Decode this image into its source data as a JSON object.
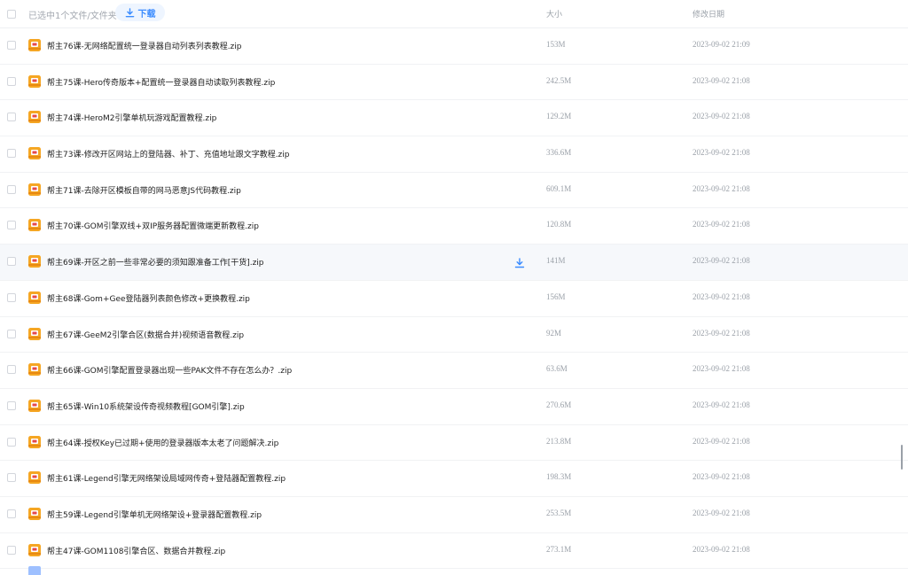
{
  "header": {
    "selection_text": "已选中1个文件/文件夹",
    "download_label": "下载",
    "col_size": "大小",
    "col_modified": "修改日期"
  },
  "colors": {
    "accent": "#3b8cff",
    "zip_orange": "#f5a623",
    "zip_red": "#e5484d"
  },
  "files": [
    {
      "name": "帮主76课-无网络配置统一登录器自动列表列表教程.zip",
      "size": "153M",
      "modified": "2023-09-02 21:09"
    },
    {
      "name": "帮主75课-Hero传奇版本+配置统一登录器自动读取列表教程.zip",
      "size": "242.5M",
      "modified": "2023-09-02 21:08"
    },
    {
      "name": "帮主74课-HeroM2引擎单机玩游戏配置教程.zip",
      "size": "129.2M",
      "modified": "2023-09-02 21:08"
    },
    {
      "name": "帮主73课-修改开区网站上的登陆器、补丁、充值地址跟文字教程.zip",
      "size": "336.6M",
      "modified": "2023-09-02 21:08"
    },
    {
      "name": "帮主71课-去除开区模板自带的网马恶意JS代码教程.zip",
      "size": "609.1M",
      "modified": "2023-09-02 21:08"
    },
    {
      "name": "帮主70课-GOM引擎双线+双IP服务器配置微端更新教程.zip",
      "size": "120.8M",
      "modified": "2023-09-02 21:08"
    },
    {
      "name": "帮主69课-开区之前一些非常必要的须知跟准备工作[干货].zip",
      "size": "141M",
      "modified": "2023-09-02 21:08"
    },
    {
      "name": "帮主68课-Gom+Gee登陆器列表颜色修改+更换教程.zip",
      "size": "156M",
      "modified": "2023-09-02 21:08"
    },
    {
      "name": "帮主67课-GeeM2引擎合区(数据合并)视频语音教程.zip",
      "size": "92M",
      "modified": "2023-09-02 21:08"
    },
    {
      "name": "帮主66课-GOM引擎配置登录器出现一些PAK文件不存在怎么办？.zip",
      "size": "63.6M",
      "modified": "2023-09-02 21:08"
    },
    {
      "name": "帮主65课-Win10系统架设传奇视频教程[GOM引擎].zip",
      "size": "270.6M",
      "modified": "2023-09-02 21:08"
    },
    {
      "name": "帮主64课-授权Key已过期+使用的登录器版本太老了问题解决.zip",
      "size": "213.8M",
      "modified": "2023-09-02 21:08"
    },
    {
      "name": "帮主61课-Legend引擎无网络架设局域网传奇+登陆器配置教程.zip",
      "size": "198.3M",
      "modified": "2023-09-02 21:08"
    },
    {
      "name": "帮主59课-Legend引擎单机无网络架设+登录器配置教程.zip",
      "size": "253.5M",
      "modified": "2023-09-02 21:08"
    },
    {
      "name": "帮主47课-GOM1108引擎合区、数据合并教程.zip",
      "size": "273.1M",
      "modified": "2023-09-02 21:08"
    }
  ]
}
